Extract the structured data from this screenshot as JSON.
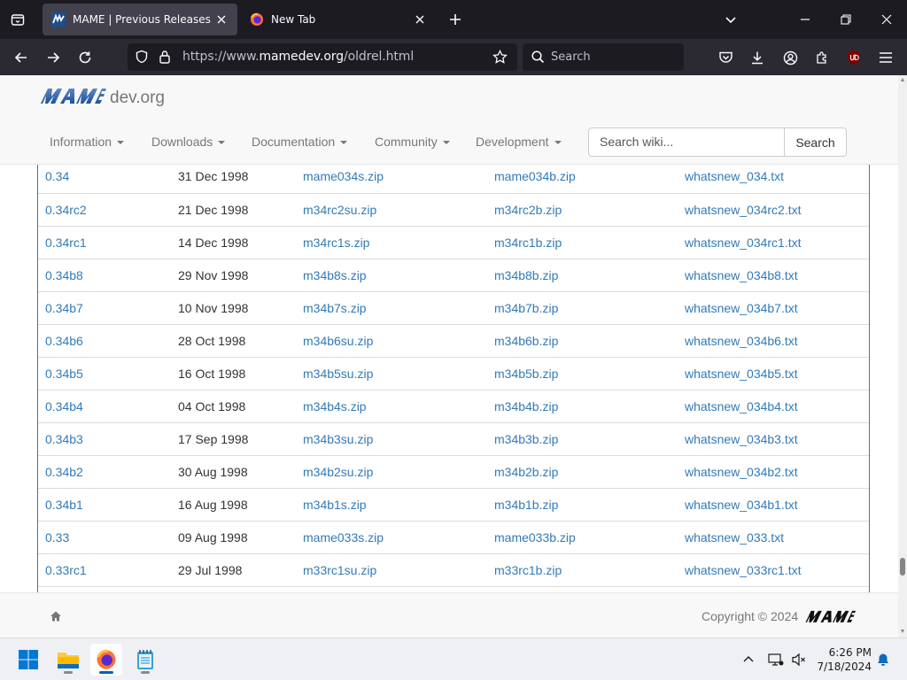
{
  "browser": {
    "tabs": [
      {
        "title": "MAME | Previous Releases",
        "active": true
      },
      {
        "title": "New Tab",
        "active": false
      }
    ],
    "url": {
      "prefix": "https://www.",
      "host": "mamedev.org",
      "path": "/oldrel.html"
    },
    "search_placeholder": "Search"
  },
  "site": {
    "brand": "dev.org",
    "nav": [
      "Information",
      "Downloads",
      "Documentation",
      "Community",
      "Development"
    ],
    "wiki_search_placeholder": "Search wiki...",
    "wiki_search_button": "Search"
  },
  "releases": [
    {
      "version": "0.34",
      "date": "31 Dec 1998",
      "source": "mame034s.zip",
      "binary": "mame034b.zip",
      "notes": "whatsnew_034.txt"
    },
    {
      "version": "0.34rc2",
      "date": "21 Dec 1998",
      "source": "m34rc2su.zip",
      "binary": "m34rc2b.zip",
      "notes": "whatsnew_034rc2.txt"
    },
    {
      "version": "0.34rc1",
      "date": "14 Dec 1998",
      "source": "m34rc1s.zip",
      "binary": "m34rc1b.zip",
      "notes": "whatsnew_034rc1.txt"
    },
    {
      "version": "0.34b8",
      "date": "29 Nov 1998",
      "source": "m34b8s.zip",
      "binary": "m34b8b.zip",
      "notes": "whatsnew_034b8.txt"
    },
    {
      "version": "0.34b7",
      "date": "10 Nov 1998",
      "source": "m34b7s.zip",
      "binary": "m34b7b.zip",
      "notes": "whatsnew_034b7.txt"
    },
    {
      "version": "0.34b6",
      "date": "28 Oct 1998",
      "source": "m34b6su.zip",
      "binary": "m34b6b.zip",
      "notes": "whatsnew_034b6.txt"
    },
    {
      "version": "0.34b5",
      "date": "16 Oct 1998",
      "source": "m34b5su.zip",
      "binary": "m34b5b.zip",
      "notes": "whatsnew_034b5.txt"
    },
    {
      "version": "0.34b4",
      "date": "04 Oct 1998",
      "source": "m34b4s.zip",
      "binary": "m34b4b.zip",
      "notes": "whatsnew_034b4.txt"
    },
    {
      "version": "0.34b3",
      "date": "17 Sep 1998",
      "source": "m34b3su.zip",
      "binary": "m34b3b.zip",
      "notes": "whatsnew_034b3.txt"
    },
    {
      "version": "0.34b2",
      "date": "30 Aug 1998",
      "source": "m34b2su.zip",
      "binary": "m34b2b.zip",
      "notes": "whatsnew_034b2.txt"
    },
    {
      "version": "0.34b1",
      "date": "16 Aug 1998",
      "source": "m34b1s.zip",
      "binary": "m34b1b.zip",
      "notes": "whatsnew_034b1.txt"
    },
    {
      "version": "0.33",
      "date": "09 Aug 1998",
      "source": "mame033s.zip",
      "binary": "mame033b.zip",
      "notes": "whatsnew_033.txt"
    },
    {
      "version": "0.33rc1",
      "date": "29 Jul 1998",
      "source": "m33rc1su.zip",
      "binary": "m33rc1b.zip",
      "notes": "whatsnew_033rc1.txt"
    }
  ],
  "footer": {
    "copyright": "Copyright © 2024"
  },
  "taskbar": {
    "time": "6:26 PM",
    "date": "7/18/2024"
  },
  "colors": {
    "link": "#337ab7",
    "chrome_dark": "#1c1b22",
    "chrome_toolbar": "#2b2a33",
    "taskbar": "#eef0f4"
  }
}
